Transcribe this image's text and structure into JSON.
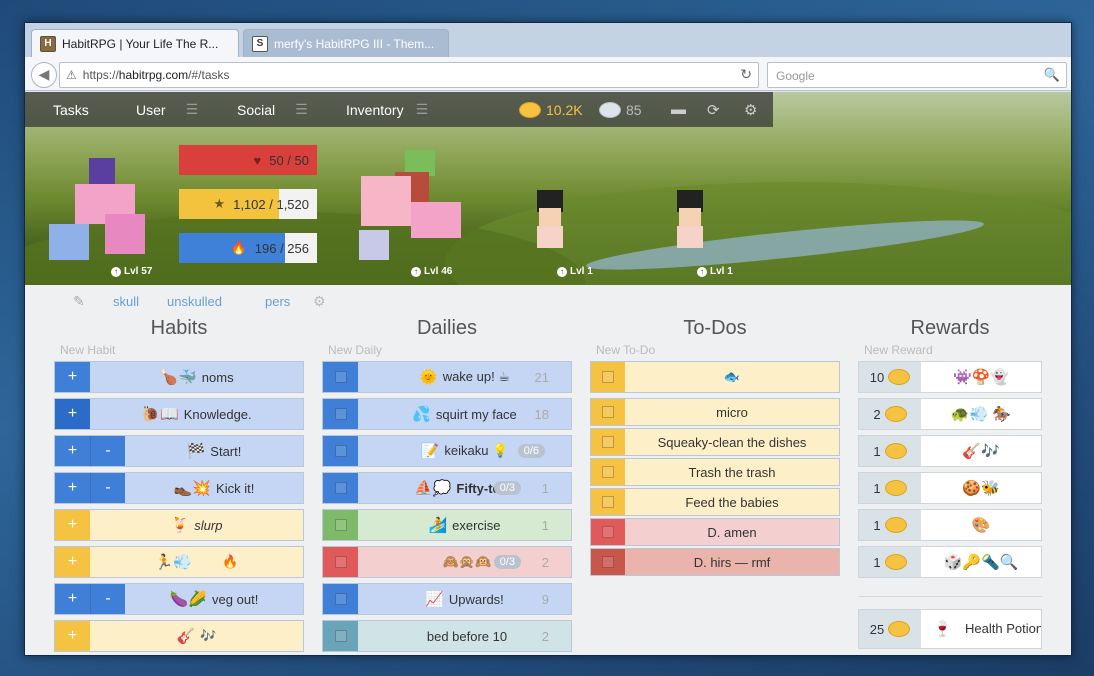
{
  "browser": {
    "tabs": [
      {
        "title": "HabitRPG | Your Life The R...",
        "favicon": "H"
      },
      {
        "title": "merfy's HabitRPG III - Them...",
        "favicon": "S"
      }
    ],
    "url_prefix": "https://",
    "url_domain": "habitrpg.com",
    "url_path": "/#/tasks",
    "search_placeholder": "Google"
  },
  "menu": {
    "items": [
      "Tasks",
      "User",
      "Social",
      "Inventory"
    ],
    "gold": "10.2K",
    "gems": "85"
  },
  "stats": {
    "health": {
      "label": "50 / 50",
      "fraction": 1.0,
      "color": "#d9403b",
      "icon": "♥"
    },
    "experience": {
      "label": "1,102 / 1,520",
      "fraction": 0.725,
      "color": "#f3c33e",
      "icon": "★"
    },
    "mana": {
      "label": "196 / 256",
      "fraction": 0.766,
      "color": "#3f80d8",
      "icon": "🔥"
    }
  },
  "party": {
    "levels": [
      "Lvl 57",
      "Lvl 46",
      "Lvl 1",
      "Lvl 1"
    ]
  },
  "tags": [
    "skull",
    "unskulled",
    "pers"
  ],
  "columns": {
    "habits": {
      "title": "Habits",
      "new_placeholder": "New Habit"
    },
    "dailies": {
      "title": "Dailies",
      "new_placeholder": "New Daily"
    },
    "todos": {
      "title": "To-Dos",
      "new_placeholder": "New To-Do"
    },
    "rewards": {
      "title": "Rewards",
      "new_placeholder": "New Reward"
    }
  },
  "habits": [
    {
      "text": "noms",
      "emoji": "🍗🐳",
      "plus": true,
      "minus": false,
      "color": "#c4d6f3",
      "ctl": "#3f7fd8"
    },
    {
      "text": "Knowledge.",
      "emoji": "🐌📖",
      "plus": true,
      "minus": false,
      "color": "#c4d6f3",
      "ctl": "#2c6cc8"
    },
    {
      "text": "Start!",
      "emoji": "🏁",
      "plus": true,
      "minus": true,
      "color": "#c4d6f3",
      "ctl": "#3f7fd8"
    },
    {
      "text": "Kick it!",
      "emoji": "👞💥",
      "plus": true,
      "minus": true,
      "color": "#c4d6f3",
      "ctl": "#3f7fd8"
    },
    {
      "text": "slurp",
      "emoji": "🍹",
      "plus": true,
      "minus": false,
      "color": "#fdf0c8",
      "ctl": "#f5c242"
    },
    {
      "text": "🔥",
      "emoji": "🏃💨",
      "plus": true,
      "minus": false,
      "color": "#fdf0c8",
      "ctl": "#f5c242"
    },
    {
      "text": "veg out!",
      "emoji": "🍆🌽",
      "plus": true,
      "minus": true,
      "color": "#c4d6f3",
      "ctl": "#3f7fd8"
    },
    {
      "text": "🎶",
      "emoji": "🎸",
      "plus": true,
      "minus": false,
      "color": "#fdf0c8",
      "ctl": "#f5c242"
    }
  ],
  "dailies": [
    {
      "text": "wake up! ☕",
      "emoji": "🌞",
      "streak": "21",
      "checklist": "",
      "color": "#c4d6f3",
      "ctl": "#3f7fd8"
    },
    {
      "text": "squirt my face",
      "emoji": "💦",
      "streak": "18",
      "checklist": "",
      "color": "#c4d6f3",
      "ctl": "#3f7fd8"
    },
    {
      "text": "keikaku 💡",
      "emoji": "📝",
      "streak": "",
      "checklist": "0/6",
      "color": "#c4d6f3",
      "ctl": "#3f7fd8"
    },
    {
      "text": "Fifty-tens",
      "emoji": "⛵💭",
      "streak": "1",
      "checklist": "0/3",
      "color": "#c4d6f3",
      "ctl": "#3f7fd8"
    },
    {
      "text": "exercise",
      "emoji": "🏄",
      "streak": "1",
      "checklist": "",
      "color": "#d5ead0",
      "ctl": "#7fba6a"
    },
    {
      "text": "🙈🙊🙉",
      "emoji": "",
      "streak": "2",
      "checklist": "0/3",
      "color": "#f4cfd0",
      "ctl": "#e05a5a"
    },
    {
      "text": "Upwards!",
      "emoji": "📈",
      "streak": "9",
      "checklist": "",
      "color": "#c4d6f3",
      "ctl": "#3f7fd8"
    },
    {
      "text": "bed before 10",
      "emoji": "",
      "streak": "2",
      "checklist": "",
      "color": "#d0e3e6",
      "ctl": "#6aa4b8"
    }
  ],
  "todos": [
    {
      "text": "🐟",
      "color": "#fdf0c8",
      "ctl": "#f5c242"
    },
    {
      "text": "micro",
      "color": "#fdf0c8",
      "ctl": "#f5c242"
    },
    {
      "text": "Squeaky-clean the dishes",
      "color": "#fdf0c8",
      "ctl": "#f5c242"
    },
    {
      "text": "Trash the trash",
      "color": "#fdf0c8",
      "ctl": "#f5c242"
    },
    {
      "text": "Feed the babies",
      "color": "#fdf0c8",
      "ctl": "#f5c242"
    },
    {
      "text": "D. amen",
      "color": "#f4cfd0",
      "ctl": "#e05a5a"
    },
    {
      "text": "D. hirs — rmf",
      "color": "#eab4ac",
      "ctl": "#c9564a"
    }
  ],
  "rewards": [
    {
      "price": "10",
      "text": "👾🍄👻"
    },
    {
      "price": "2",
      "text": "🐢💨 🏇"
    },
    {
      "price": "1",
      "text": "🎸🎶"
    },
    {
      "price": "1",
      "text": "🍪🐝"
    },
    {
      "price": "1",
      "text": "🎨"
    },
    {
      "price": "1",
      "text": "🎲🔑🔦🔍"
    }
  ],
  "health_potion": {
    "price": "25",
    "label": "Health Potion",
    "icon": "🍷"
  }
}
